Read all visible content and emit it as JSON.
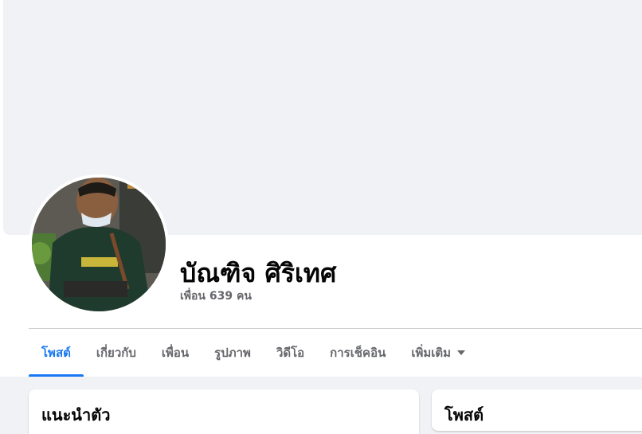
{
  "profile": {
    "name": "บัณฑิจ ศิริเทศ",
    "friends": "เพื่อน 639 คน"
  },
  "tabs": [
    {
      "label": "โพสต์",
      "active": true
    },
    {
      "label": "เกี่ยวกับ",
      "active": false
    },
    {
      "label": "เพื่อน",
      "active": false
    },
    {
      "label": "รูปภาพ",
      "active": false
    },
    {
      "label": "วิดีโอ",
      "active": false
    },
    {
      "label": "การเช็คอิน",
      "active": false
    },
    {
      "label": "เพิ่มเติม",
      "active": false,
      "icon": "chevron-down-icon"
    }
  ],
  "cards": {
    "intro_title": "แนะนำตัว",
    "posts_title": "โพสต์"
  },
  "colors": {
    "accent": "#1877f2",
    "background": "#f0f2f5",
    "secondary_text": "#65676b"
  }
}
